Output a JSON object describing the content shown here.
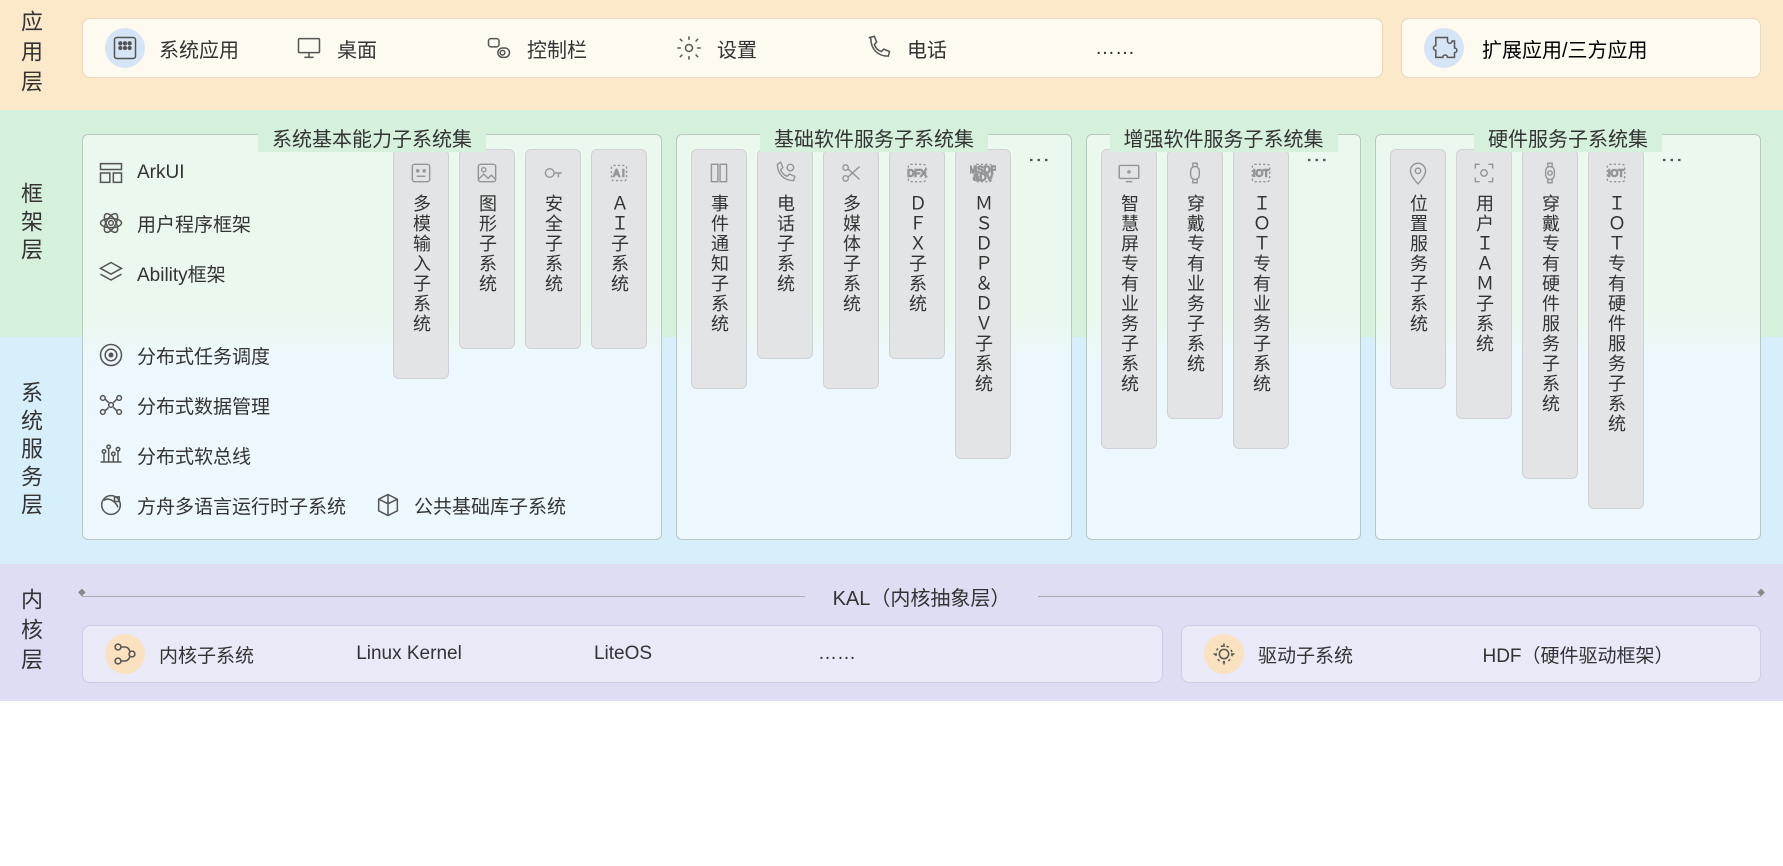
{
  "layers": {
    "app": "应用层",
    "framework": "框架层",
    "service": "系统服务层",
    "kernel": "内核层"
  },
  "app": {
    "system_apps": "系统应用",
    "desktop": "桌面",
    "control_bar": "控制栏",
    "settings": "设置",
    "phone": "电话",
    "more": "……",
    "extended": "扩展应用/三方应用"
  },
  "groups": {
    "basic": "系统基本能力子系统集",
    "base_sw": "基础软件服务子系统集",
    "enhanced": "增强软件服务子系统集",
    "hardware": "硬件服务子系统集"
  },
  "basic_left": {
    "arkui": "ArkUI",
    "user_fw": "用户程序框架",
    "ability_fw": "Ability框架",
    "dist_sched": "分布式任务调度",
    "dist_data": "分布式数据管理",
    "dist_softbus": "分布式软总线",
    "ark_runtime": "方舟多语言运行时子系统",
    "common_lib": "公共基础库子系统"
  },
  "basic_right": {
    "multi_input": "多模输入子系统",
    "graphics": "图形子系统",
    "security": "安全子系统",
    "ai": "ＡＩ子系统"
  },
  "base_sw": {
    "event": "事件通知子系统",
    "telephony": "电话子系统",
    "multimedia": "多媒体子系统",
    "dfx": "ＤＦＸ子系统",
    "msdp": "ＭＳＤＰ＆ＤＶ子系统",
    "more": "⋮"
  },
  "enhanced": {
    "smart_screen": "智慧屏专有业务子系统",
    "wearable": "穿戴专有业务子系统",
    "iot": "ＩＯＴ专有业务子系统",
    "more": "⋮"
  },
  "hardware": {
    "location": "位置服务子系统",
    "user_iam": "用户ＩＡＭ子系统",
    "wearable_hw": "穿戴专有硬件服务子系统",
    "iot_hw": "ＩＯＴ专有硬件服务子系统",
    "more": "⋮"
  },
  "kernel": {
    "kal": "KAL（内核抽象层）",
    "kernel_sub": "内核子系统",
    "linux": "Linux Kernel",
    "liteos": "LiteOS",
    "more": "……",
    "driver_sub": "驱动子系统",
    "hdf": "HDF（硬件驱动框架）"
  }
}
